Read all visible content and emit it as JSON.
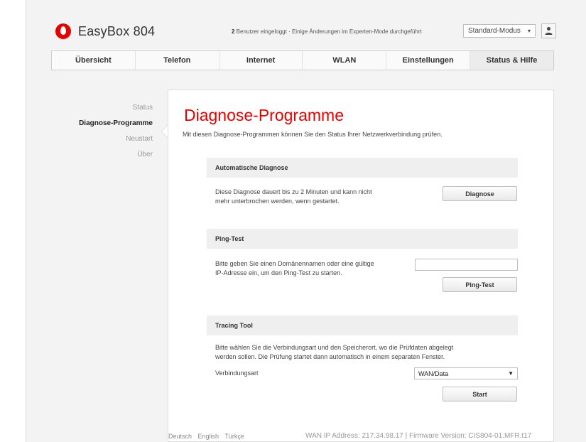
{
  "header": {
    "brand": "EasyBox 804",
    "users_count": "2",
    "users_text": " Benutzer eingeloggt · Einige Änderungen im Experten-Mode durchgeführt",
    "mode_value": "Standard-Modus",
    "user_icon": "user-icon"
  },
  "nav": {
    "tabs": [
      {
        "label": "Übersicht"
      },
      {
        "label": "Telefon"
      },
      {
        "label": "Internet"
      },
      {
        "label": "WLAN"
      },
      {
        "label": "Einstellungen"
      },
      {
        "label": "Status & Hilfe"
      }
    ]
  },
  "sidebar": {
    "items": [
      {
        "label": "Status"
      },
      {
        "label": "Diagnose-Programme"
      },
      {
        "label": "Neustart"
      },
      {
        "label": "Über"
      }
    ]
  },
  "main": {
    "title": "Diagnose-Programme",
    "subtitle": "Mit diesen Diagnose-Programmen können Sie den Status Ihrer Netzwerkverbindung prüfen.",
    "auto": {
      "heading": "Automatische Diagnose",
      "line1": "Diese Diagnose dauert bis zu 2 Minuten und kann nicht",
      "line2": "mehr unterbrochen werden, wenn gestartet.",
      "button": "Diagnose"
    },
    "ping": {
      "heading": "Ping-Test",
      "line1": "Bitte geben Sie einen Domänennamen oder eine gültige",
      "line2": "IP-Adresse ein, um den Ping-Test zu starten.",
      "input_value": "",
      "button": "Ping-Test"
    },
    "tracing": {
      "heading": "Tracing Tool",
      "line1": "Bitte wählen Sie die Verbindungsart und den Speicherort, wo die Prüfdaten abgelegt",
      "line2": "werden sollen. Die Prüfung startet dann automatisch in einem separaten Fenster.",
      "field_label": "Verbindungsart",
      "select_value": "WAN/Data",
      "button": "Start"
    }
  },
  "footer": {
    "languages": [
      "Deutsch",
      "English",
      "Türkçe"
    ],
    "info": "WAN IP Address: 217.34.98.17 | Firmware Version: CIS804-01.MFR.t17"
  },
  "colors": {
    "accent": "#e60000",
    "background": "#f3f3f3",
    "panel": "#ffffff",
    "section_header": "#efefef"
  }
}
